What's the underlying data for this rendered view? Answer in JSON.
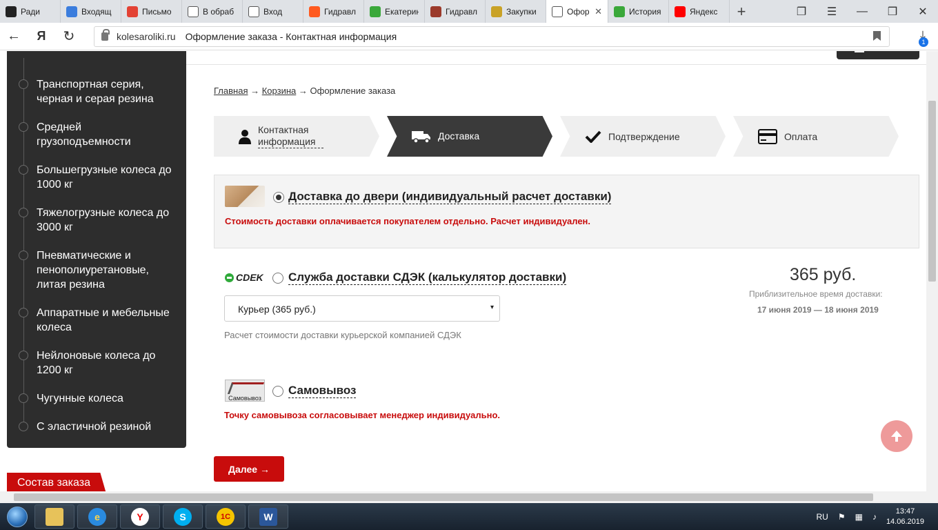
{
  "browser": {
    "tabs": [
      {
        "label": "Ради",
        "icon_color": "#222222",
        "icon": "mail-icon"
      },
      {
        "label": "Входящ",
        "icon_color": "#3b7ddd",
        "icon": "at-icon"
      },
      {
        "label": "Письмо",
        "icon_color": "#e34234",
        "icon": "gmail-icon"
      },
      {
        "label": "В обраб",
        "icon_color": "#ffffff",
        "icon": "page-icon"
      },
      {
        "label": "Вход",
        "icon_color": "#ffffff",
        "icon": "page-icon"
      },
      {
        "label": "Гидравл",
        "icon_color": "#ff5a1f",
        "icon": "n-logo-icon"
      },
      {
        "label": "Екатерин",
        "icon_color": "#3aa83a",
        "icon": "green-leaf-icon"
      },
      {
        "label": "Гидравл",
        "icon_color": "#9b3a2b",
        "icon": "photo-icon"
      },
      {
        "label": "Закупки",
        "icon_color": "#c9a227",
        "icon": "emblem-icon"
      },
      {
        "label": "Офор",
        "icon_color": "#ffffff",
        "icon": "page-icon",
        "active": true
      },
      {
        "label": "История",
        "icon_color": "#3aa83a",
        "icon": "green-leaf-icon"
      },
      {
        "label": "Яндекс",
        "icon_color": "#ff0000",
        "icon": "yandex-icon"
      }
    ],
    "new_tab": "+",
    "url_domain": "kolesaroliki.ru",
    "url_title": "Оформление заказа - Контактная информация",
    "download_badge": "1"
  },
  "sidebar": {
    "categories": [
      "Транспортная серия, черная и серая резина",
      "Средней грузоподъемности",
      "Большегрузные колеса до 1000 кг",
      "Тяжелогрузные колеса до 3000 кг",
      "Пневматические и пенополиуретановые, литая резина",
      "Аппаратные и мебельные колеса",
      "Нейлоновые колеса до 1200 кг",
      "Чугунные колеса",
      "С эластичной резиной"
    ],
    "order_tab": "Состав заказа"
  },
  "breadcrumbs": {
    "home": "Главная",
    "cart": "Корзина",
    "sep": "→",
    "current": "Оформление заказа"
  },
  "steps": [
    {
      "label": "Контактная информация",
      "icon": "person-icon",
      "state": "done"
    },
    {
      "label": "Доставка",
      "icon": "truck-icon",
      "state": "active"
    },
    {
      "label": "Подтверждение",
      "icon": "check-icon",
      "state": "pending"
    },
    {
      "label": "Оплата",
      "icon": "card-icon",
      "state": "pending"
    }
  ],
  "delivery": {
    "door": {
      "title": "Доставка до двери (индивидуальный расчет доставки)",
      "note": "Стоимость доставки оплачивается покупателем отдельно. Расчет индивидуален.",
      "selected": true
    },
    "cdek": {
      "logo_text": "CDEK",
      "title": "Служба доставки СДЭК (калькулятор доставки)",
      "select_value": "Курьер (365 руб.)",
      "select_arrow": "▾",
      "note": "Расчет стоимости доставки курьерской компанией СДЭК",
      "price": "365 руб.",
      "eta_label": "Приблизительное время доставки:",
      "eta_value": "17 июня 2019 — 18 июня 2019",
      "selected": false
    },
    "pickup": {
      "img_caption": "Самовывоз",
      "title": "Самовывоз",
      "note": "Точку самовывоза согласовывает менеджер индивидуально.",
      "selected": false
    }
  },
  "next_button": "Далее →",
  "taskbar": {
    "lang": "RU",
    "time": "13:47",
    "date": "14.06.2019"
  },
  "colors": {
    "accent_red": "#c80c0c",
    "sidebar_bg": "#2d2d2d",
    "step_active": "#3a3a3a",
    "step_inactive": "#efefef"
  }
}
